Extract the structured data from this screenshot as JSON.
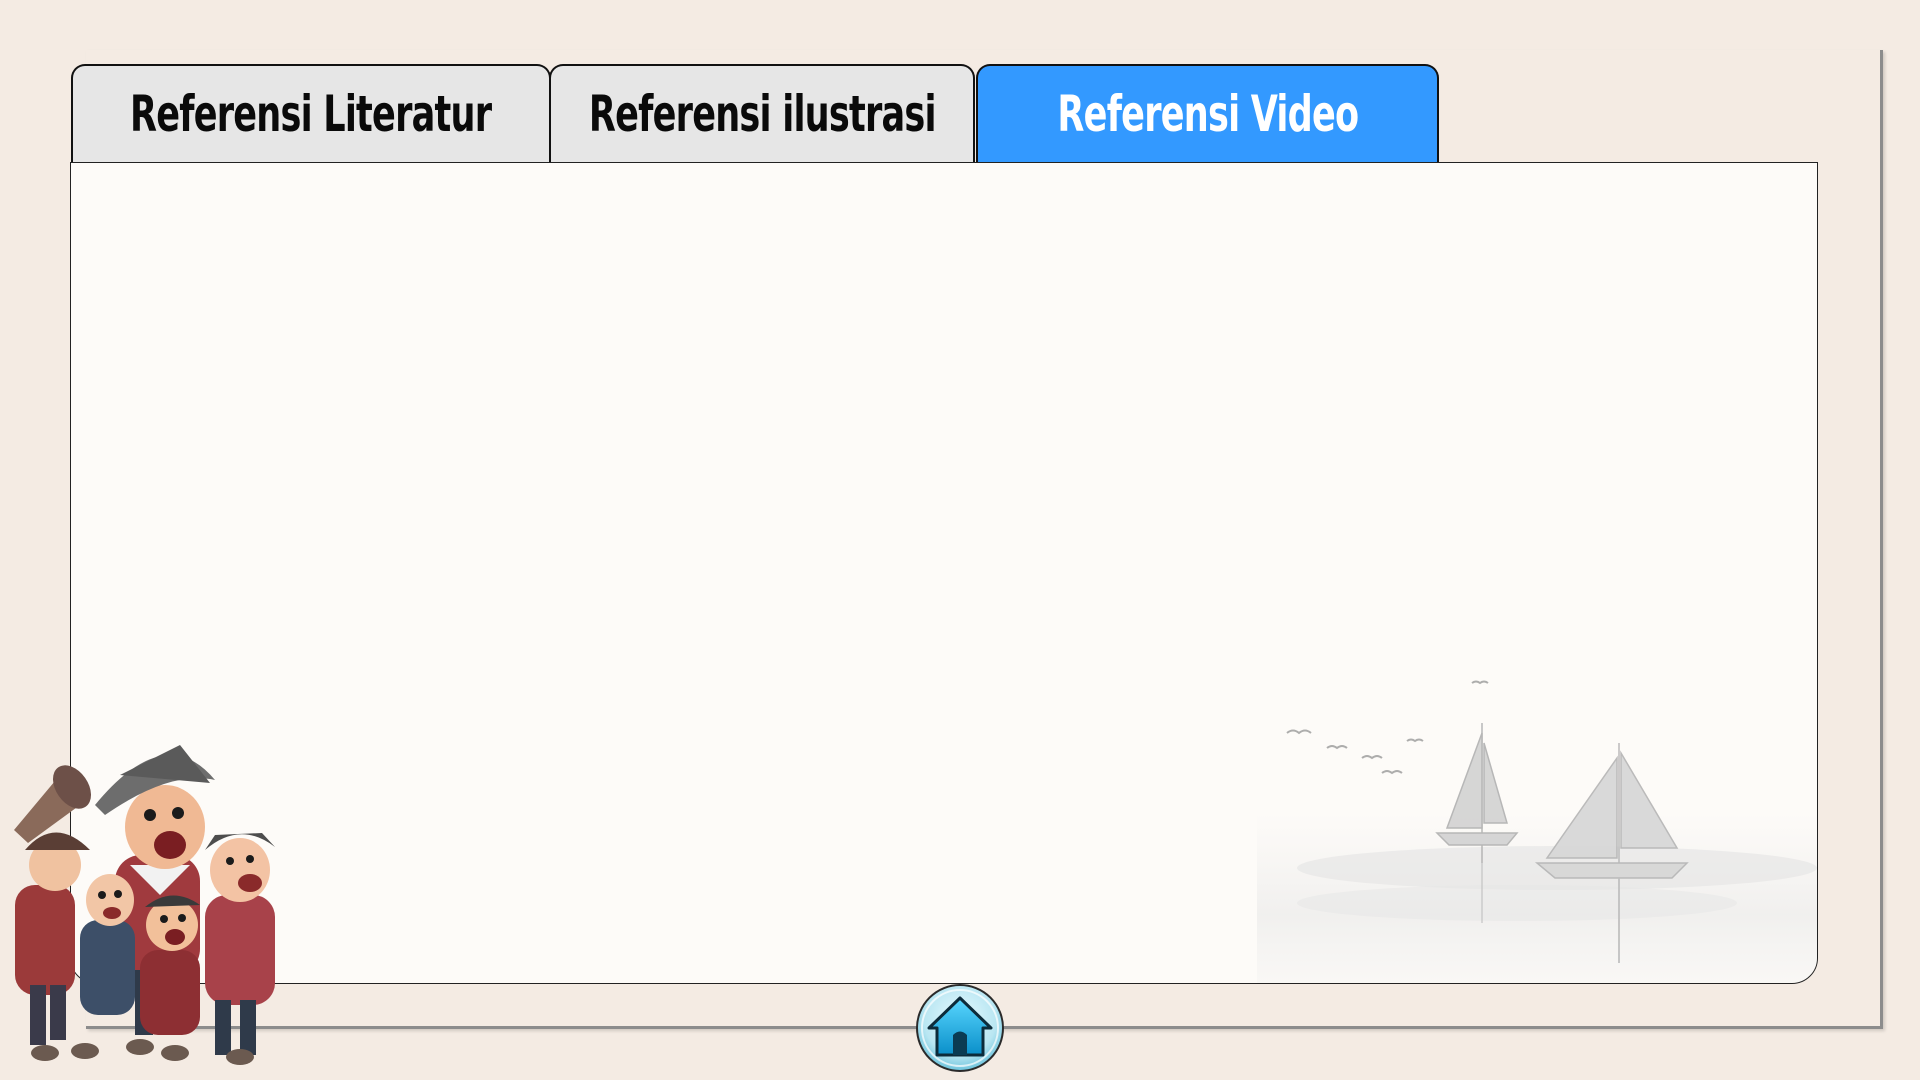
{
  "tabs": [
    {
      "label": "Referensi Literatur",
      "active": false
    },
    {
      "label": "Referensi ilustrasi",
      "active": false
    },
    {
      "label": "Referensi Video",
      "active": true
    }
  ],
  "colors": {
    "background": "#f4ebe3",
    "tab_active": "#3399ff",
    "tab_inactive": "#e6e6e6",
    "panel": "#fdfbf8",
    "home_button": "#1ab2e8"
  },
  "icons": {
    "home": "home-icon",
    "decoration_left": "pirate-crew-illustration",
    "decoration_right": "sailboats-sketch"
  }
}
